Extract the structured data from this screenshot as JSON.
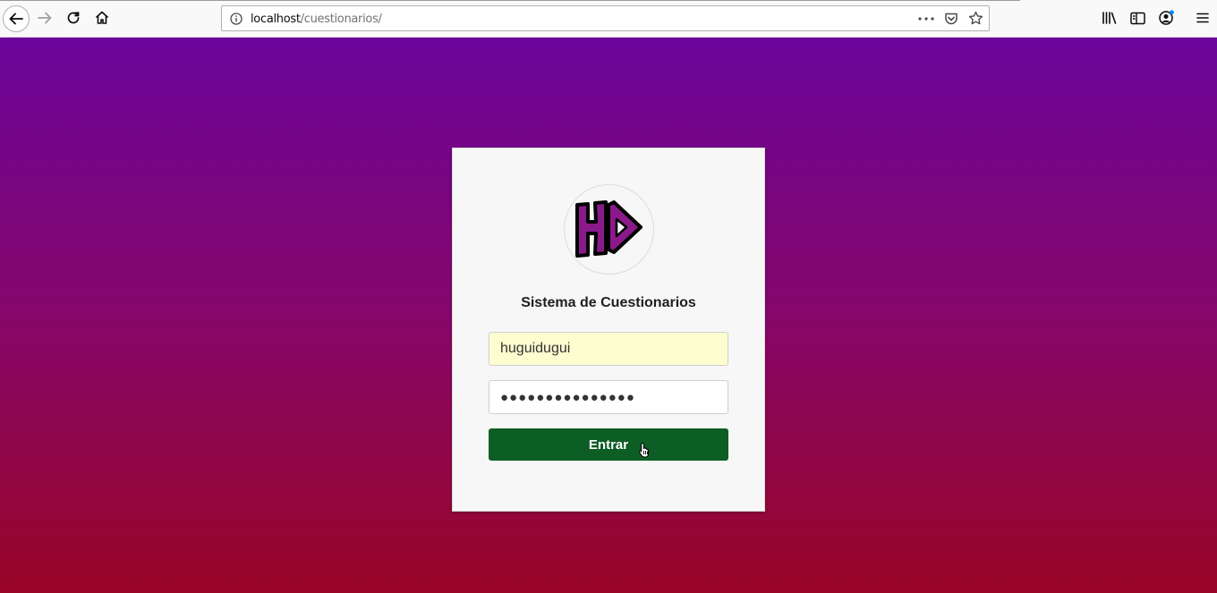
{
  "browser": {
    "url_host": "localhost",
    "url_path": "/cuestionarios/"
  },
  "login": {
    "logo_text": "HD",
    "title": "Sistema de Cuestionarios",
    "username_value": "huguidugui",
    "password_value": "●●●●●●●●●●●●●●●",
    "submit_label": "Entrar"
  },
  "colors": {
    "bg_top": "#6b059b",
    "bg_bottom": "#9a0627",
    "submit": "#0d5e24",
    "autofill": "#fefdd0"
  },
  "icons": [
    "back-arrow-icon",
    "forward-arrow-icon",
    "reload-icon",
    "home-icon",
    "info-icon",
    "more-dots-icon",
    "pocket-icon",
    "star-icon",
    "library-icon",
    "sidebar-icon",
    "account-icon",
    "menu-icon",
    "hand-cursor-icon"
  ]
}
